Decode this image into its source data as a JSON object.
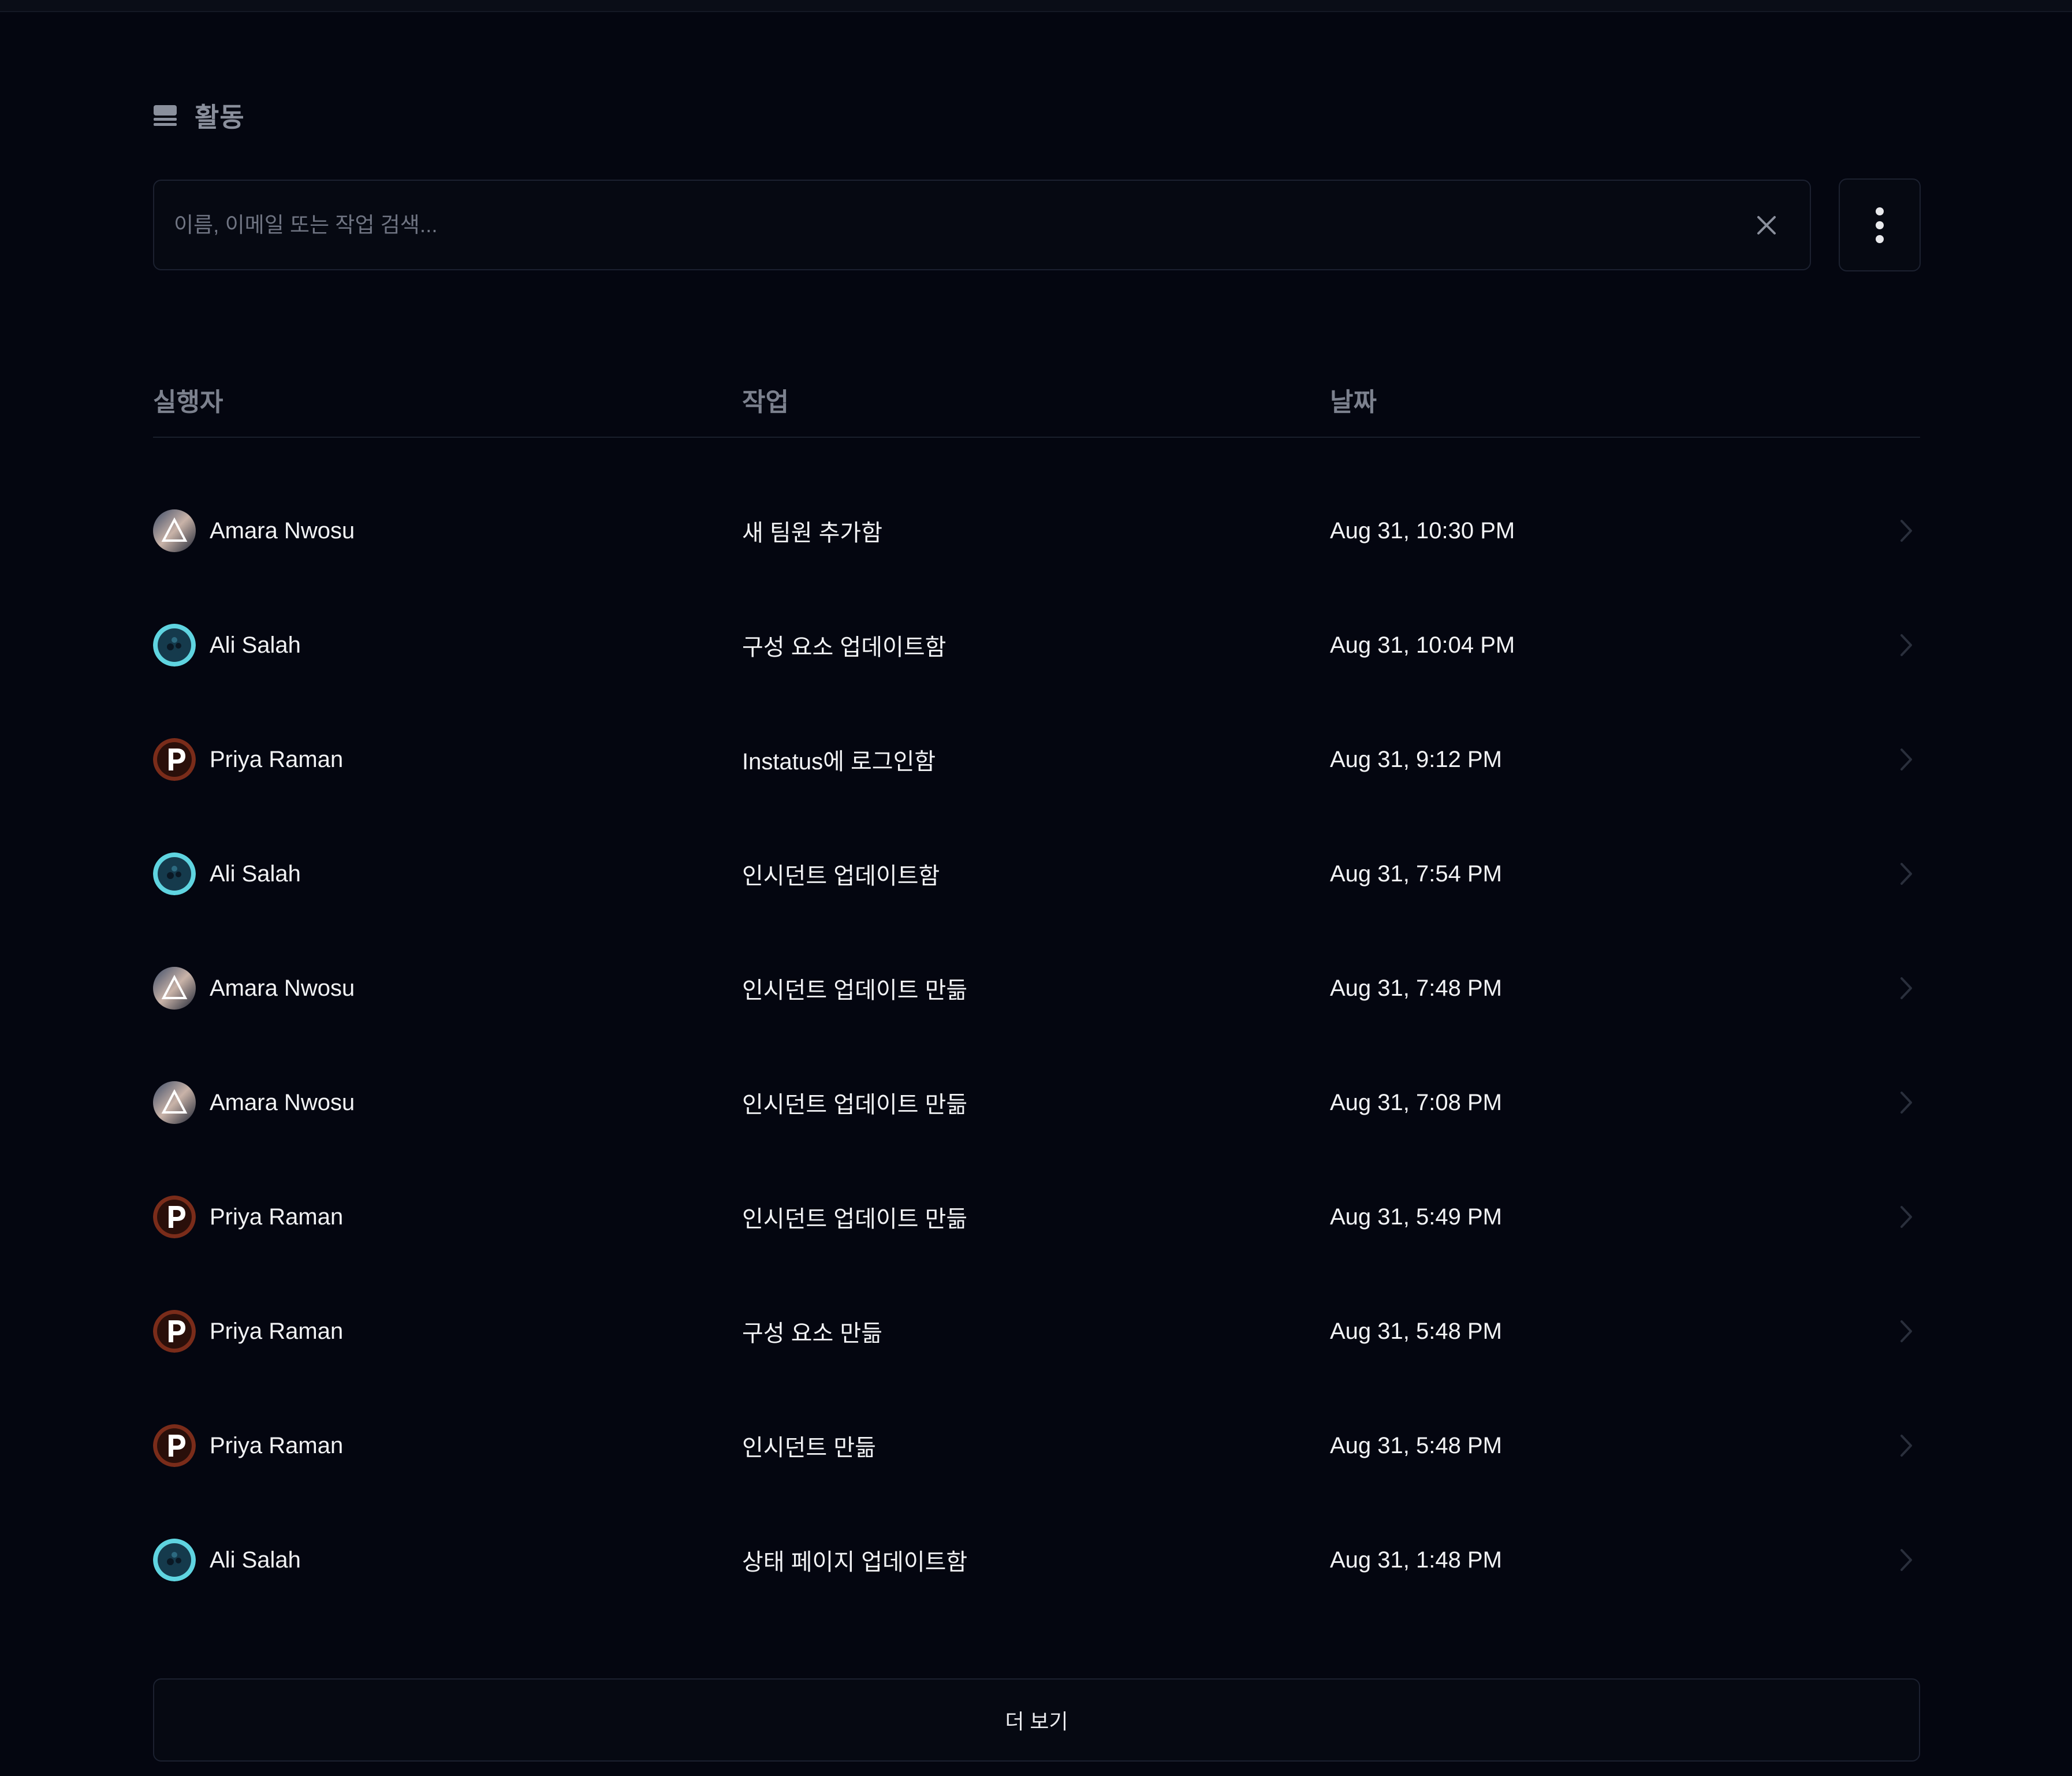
{
  "header": {
    "title": "활동",
    "icon": "list-icon"
  },
  "search": {
    "placeholder": "이름, 이메일 또는 작업 검색...",
    "value": ""
  },
  "table": {
    "columns": {
      "actor": "실행자",
      "action": "작업",
      "date": "날짜"
    },
    "rows": [
      {
        "actor": "Amara Nwosu",
        "avatar": "amara",
        "action": "새 팀원 추가함",
        "date": "Aug 31, 10:30 PM"
      },
      {
        "actor": "Ali Salah",
        "avatar": "ali",
        "action": "구성 요소 업데이트함",
        "date": "Aug 31, 10:04 PM"
      },
      {
        "actor": "Priya Raman",
        "avatar": "priya",
        "action": "Instatus에 로그인함",
        "date": "Aug 31, 9:12 PM"
      },
      {
        "actor": "Ali Salah",
        "avatar": "ali",
        "action": "인시던트 업데이트함",
        "date": "Aug 31, 7:54 PM"
      },
      {
        "actor": "Amara Nwosu",
        "avatar": "amara",
        "action": "인시던트 업데이트 만듦",
        "date": "Aug 31, 7:48 PM"
      },
      {
        "actor": "Amara Nwosu",
        "avatar": "amara",
        "action": "인시던트 업데이트 만듦",
        "date": "Aug 31, 7:08 PM"
      },
      {
        "actor": "Priya Raman",
        "avatar": "priya",
        "action": "인시던트 업데이트 만듦",
        "date": "Aug 31, 5:49 PM"
      },
      {
        "actor": "Priya Raman",
        "avatar": "priya",
        "action": "구성 요소 만듦",
        "date": "Aug 31, 5:48 PM"
      },
      {
        "actor": "Priya Raman",
        "avatar": "priya",
        "action": "인시던트 만듦",
        "date": "Aug 31, 5:48 PM"
      },
      {
        "actor": "Ali Salah",
        "avatar": "ali",
        "action": "상태 페이지 업데이트함",
        "date": "Aug 31, 1:48 PM"
      }
    ]
  },
  "load_more": {
    "label": "더 보기"
  },
  "colors": {
    "background": "#040610",
    "border": "#1c2130",
    "muted_text": "#7c818e",
    "text": "#f2f3f5"
  }
}
